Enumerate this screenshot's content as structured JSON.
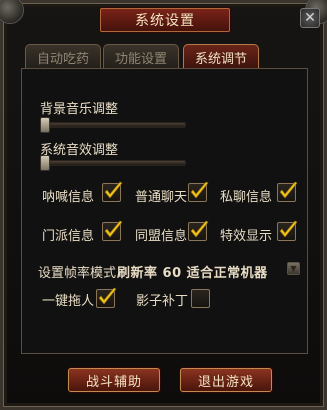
{
  "window": {
    "title": "系统设置",
    "close_label": "✕"
  },
  "tabs": [
    {
      "label": "自动吃药",
      "active": false
    },
    {
      "label": "功能设置",
      "active": false
    },
    {
      "label": "系统调节",
      "active": true
    }
  ],
  "audio": {
    "music_label": "背景音乐调整",
    "music_level": 0.0,
    "effects_label": "系统音效调整",
    "effects_level": 0.0
  },
  "options": [
    {
      "label": "呐喊信息",
      "checked": true
    },
    {
      "label": "普通聊天",
      "checked": true
    },
    {
      "label": "私聊信息",
      "checked": true
    },
    {
      "label": "门派信息",
      "checked": true
    },
    {
      "label": "同盟信息",
      "checked": true
    },
    {
      "label": "特效显示",
      "checked": true
    }
  ],
  "framerate": {
    "label": "设置帧率模式",
    "value": "刷新率 60  适合正常机器"
  },
  "extras": [
    {
      "label": "一键拖人",
      "checked": true
    },
    {
      "label": "影子补丁",
      "checked": false
    }
  ],
  "buttons": {
    "assist": "战斗辅助",
    "exit": "退出游戏"
  },
  "colors": {
    "accent": "#f2c418",
    "title_bg": "#6a1d14"
  }
}
